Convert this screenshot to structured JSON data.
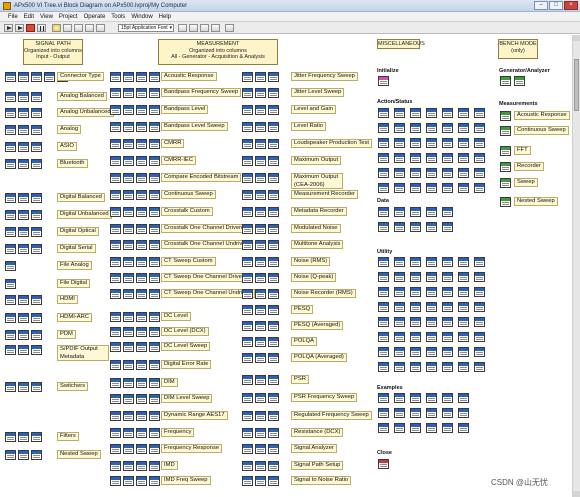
{
  "window": {
    "title": "APx500 VI Tree.vi Block Diagram on APx500.lvproj/My Computer",
    "buttons": [
      "–",
      "□",
      "×"
    ]
  },
  "menu": [
    "File",
    "Edit",
    "View",
    "Project",
    "Operate",
    "Tools",
    "Window",
    "Help"
  ],
  "toolbar": {
    "font_selector": "15pt Application Font"
  },
  "headers": {
    "signal_path": "SIGNAL PATH\nOrganized into columns\nInput - Output",
    "measurement": "MEASUREMENT\nOrganized into columns\nAll - Generator - Acquisition & Analysis",
    "misc": "MISCELLANEOUS",
    "bench": "BENCH MODE\n(only)"
  },
  "signal_path_labels": [
    "Connector Type",
    "Analog Balanced",
    "Analog Unbalanced",
    "Analog",
    "ASIO",
    "Bluetooth",
    "Digital Balanced",
    "Digital Unbalanced",
    "Digital Optical",
    "Digital Serial",
    "File Analog",
    "File Digital",
    "HDMI",
    "HDMI-ARC",
    "PDM",
    "S/PDIF Output Metadata",
    "Switchers",
    "Filters",
    "Nested Sweep"
  ],
  "measurement_col1": [
    "Acoustic Response",
    "Bandpass Frequency Sweep",
    "Bandpass Level",
    "Bandpass Level Sweep",
    "CMRR",
    "CMRR-IEC",
    "Compare Encoded Bitstream",
    "Continuous Sweep",
    "Crosstalk Custom",
    "Crosstalk One Channel Driven",
    "Crosstalk One Channel Undriven",
    "CT Sweep Custom",
    "CT Sweep One Channel Driven",
    "CT Sweep One Channel Undriven",
    "DC Level",
    "DC Level (DCX)",
    "DC Level Sweep",
    "Digital Error Rate",
    "DIM",
    "DIM Level Sweep",
    "Dynamic Range AES17",
    "Frequency",
    "Frequency Response",
    "IMD",
    "IMD Freq Sweep"
  ],
  "measurement_col2": [
    "Jitter Frequency Sweep",
    "Jitter Level Sweep",
    "Level and Gain",
    "Level Ratio",
    "Loudspeaker Production Test",
    "Maximum Output",
    "Maximum Output (CEA-2006) (Burst)",
    "Measurement Recorder",
    "Metadata Recorder",
    "Modulated Noise",
    "Multitone Analysis",
    "Noise (RMS)",
    "Noise (Q-peak)",
    "Noise Recorder (RMS)",
    "PESQ",
    "PESQ (Averaged)",
    "POLQA",
    "POLQA (Averaged)",
    "PSR",
    "PSR Frequency Sweep",
    "Regulated Frequency Sweep",
    "Resistance (DCX)",
    "Signal Analyzer",
    "Signal Path Setup",
    "Signal to Noise Ratio"
  ],
  "misc_sections": [
    "Initialize",
    "Action/Status",
    "Data",
    "Utility",
    "Examples",
    "Close"
  ],
  "bench_sections": [
    "Generator/Analyzer",
    "Measurements"
  ],
  "bench_labels": [
    "Acoustic Response",
    "Continuous Sweep",
    "FFT",
    "Recorder",
    "Sweep",
    "Nested Sweep"
  ],
  "watermark": "CSDN @山无忧"
}
